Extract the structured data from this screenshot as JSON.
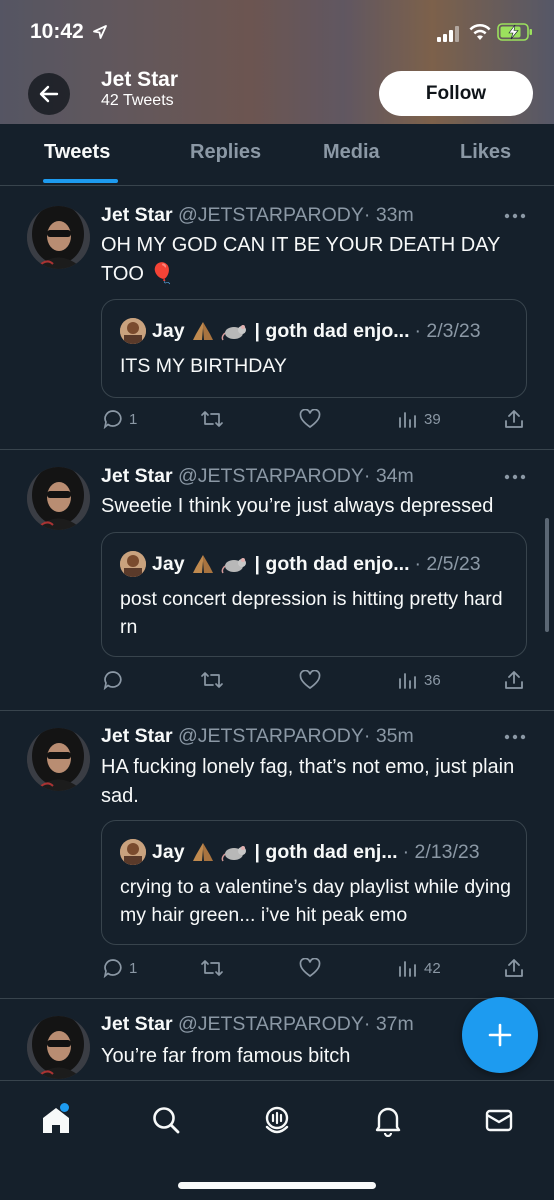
{
  "status_bar": {
    "time": "10:42"
  },
  "header": {
    "profile_name": "Jet Star",
    "tweet_count": "42 Tweets",
    "follow_label": "Follow"
  },
  "tabs": [
    {
      "label": "Tweets",
      "active": true
    },
    {
      "label": "Replies",
      "active": false
    },
    {
      "label": "Media",
      "active": false
    },
    {
      "label": "Likes",
      "active": false
    }
  ],
  "tweets": [
    {
      "name": "Jet Star",
      "handle": "@JETSTARPARODY",
      "time": "· 33m",
      "text": "OH MY GOD CAN IT BE YOUR DEATH DAY TOO 🎈",
      "quote": {
        "name": "Jay",
        "name_suffix": "| goth dad enjo...",
        "date": "· 2/3/23",
        "text": "ITS MY BIRTHDAY"
      },
      "replies": "1",
      "retweets": "",
      "likes": "",
      "views": "39"
    },
    {
      "name": "Jet Star",
      "handle": "@JETSTARPARODY",
      "time": "· 34m",
      "text": "Sweetie I think you’re just always depressed",
      "quote": {
        "name": "Jay",
        "name_suffix": "| goth dad enjo...",
        "date": "· 2/5/23",
        "text": "post concert depression is hitting pretty hard rn"
      },
      "replies": "",
      "retweets": "",
      "likes": "",
      "views": "36"
    },
    {
      "name": "Jet Star",
      "handle": "@JETSTARPARODY",
      "time": "· 35m",
      "text": "HA fucking lonely fag, that’s not emo, just plain sad.",
      "quote": {
        "name": "Jay",
        "name_suffix": "| goth dad enj...",
        "date": "· 2/13/23",
        "text": "crying to a valentine’s day playlist while dying my hair green... i’ve hit peak emo"
      },
      "replies": "1",
      "retweets": "",
      "likes": "",
      "views": "42"
    },
    {
      "name": "Jet Star",
      "handle": "@JETSTARPARODY",
      "time": "· 37m",
      "text": "You’re far from famous bitch"
    }
  ],
  "icons": {
    "quote_emojis": [
      "praying-hands",
      "rat"
    ],
    "accent": "#1d9bf0",
    "background": "#15202b"
  }
}
